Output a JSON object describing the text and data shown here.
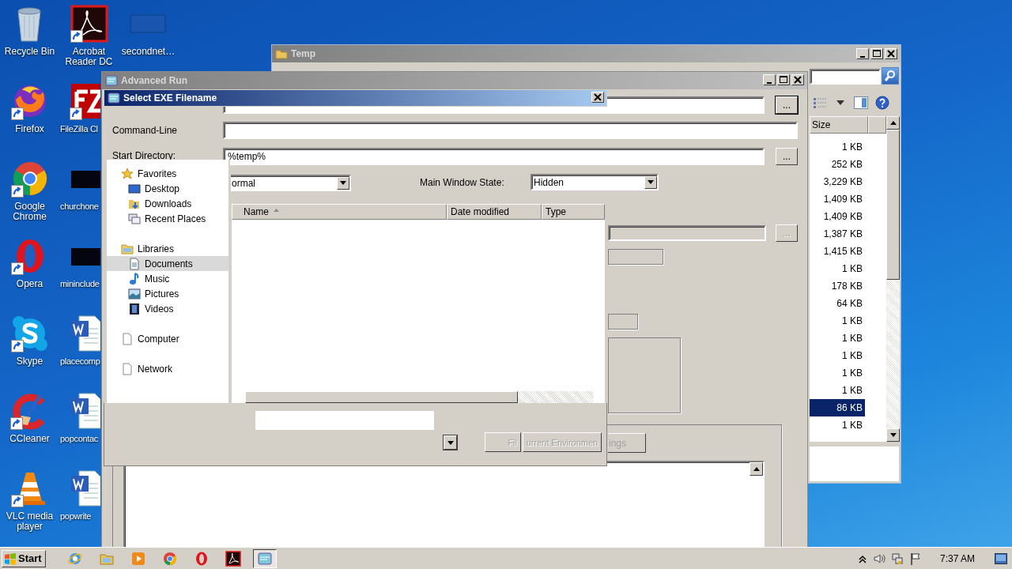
{
  "desktop": {
    "icons": [
      {
        "label": "Recycle Bin",
        "kind": "recycle",
        "shortcut": false
      },
      {
        "label": "Firefox",
        "kind": "firefox",
        "shortcut": true
      },
      {
        "label": "Google Chrome",
        "kind": "chrome",
        "shortcut": true
      },
      {
        "label": "Opera",
        "kind": "opera",
        "shortcut": true
      },
      {
        "label": "Skype",
        "kind": "skype",
        "shortcut": true
      },
      {
        "label": "CCleaner",
        "kind": "ccleaner",
        "shortcut": true
      },
      {
        "label": "VLC media player",
        "kind": "vlc",
        "shortcut": true
      },
      {
        "label": "Acrobat Reader DC",
        "kind": "acrobat",
        "shortcut": true
      },
      {
        "label": "FileZilla Cl",
        "kind": "filezilla",
        "shortcut": true
      },
      {
        "label": "churchone",
        "kind": "dark",
        "shortcut": false
      },
      {
        "label": "mininclude",
        "kind": "dark",
        "shortcut": false
      },
      {
        "label": "placecomp",
        "kind": "word",
        "shortcut": false
      },
      {
        "label": "popcontac",
        "kind": "word",
        "shortcut": false
      },
      {
        "label": "popwrite",
        "kind": "word",
        "shortcut": false
      },
      {
        "label": "secondnet…",
        "kind": "blank",
        "shortcut": false
      }
    ]
  },
  "explorer_window": {
    "title": "Temp",
    "columns": [
      "Size"
    ],
    "rows": [
      {
        "size": "1 KB",
        "selected": false
      },
      {
        "size": "252 KB",
        "selected": false
      },
      {
        "size": "3,229 KB",
        "selected": false
      },
      {
        "size": "1,409 KB",
        "selected": false
      },
      {
        "size": "1,409 KB",
        "selected": false
      },
      {
        "size": "1,387 KB",
        "selected": false
      },
      {
        "size": "1,415 KB",
        "selected": false
      },
      {
        "size": "1 KB",
        "selected": false
      },
      {
        "size": "178 KB",
        "selected": false
      },
      {
        "size": "64 KB",
        "selected": false
      },
      {
        "size": "1 KB",
        "selected": false
      },
      {
        "size": "1 KB",
        "selected": false
      },
      {
        "size": "1 KB",
        "selected": false
      },
      {
        "size": "1 KB",
        "selected": false
      },
      {
        "size": "1 KB",
        "selected": false
      },
      {
        "size": "86 KB",
        "selected": true
      },
      {
        "size": "1 KB",
        "selected": false
      }
    ]
  },
  "advanced_run": {
    "title": "Advanced Run",
    "command_line_label": "Command-Line",
    "start_directory_label": "Start Directory:",
    "start_directory": "%temp%",
    "window_mode": "ormal",
    "main_window_state_label": "Main Window State:",
    "main_window_state": "Hidden",
    "browse_buttons": [
      {
        "label": "...",
        "disabled": false
      },
      {
        "label": "...",
        "disabled": false
      },
      {
        "label": "...",
        "disabled": true
      }
    ],
    "settings_button": "ings"
  },
  "file_dialog": {
    "title": "Select EXE Filename",
    "nav": [
      {
        "label": "Favorites",
        "kind": "star",
        "selected": false,
        "children": [
          {
            "label": "Desktop",
            "kind": "desktop",
            "selected": false
          },
          {
            "label": "Downloads",
            "kind": "downloads",
            "selected": false
          },
          {
            "label": "Recent Places",
            "kind": "recent",
            "selected": false
          }
        ]
      },
      {
        "label": "Libraries",
        "kind": "libraries",
        "selected": false,
        "children": [
          {
            "label": "Documents",
            "kind": "document",
            "selected": true
          },
          {
            "label": "Music",
            "kind": "music",
            "selected": false
          },
          {
            "label": "Pictures",
            "kind": "pictures",
            "selected": false
          },
          {
            "label": "Videos",
            "kind": "videos",
            "selected": false
          }
        ]
      },
      {
        "label": "Computer",
        "kind": "page",
        "selected": false
      },
      {
        "label": "Network",
        "kind": "page",
        "selected": false
      }
    ],
    "columns": [
      {
        "label": "Name",
        "sorted": true
      },
      {
        "label": "Date modified",
        "sorted": false
      },
      {
        "label": "Type",
        "sorted": false
      }
    ],
    "buttons": [
      {
        "label": "Fil",
        "disabled": true
      },
      {
        "label": "urrent Environmen",
        "disabled": true
      }
    ]
  },
  "taskbar": {
    "start": "Start",
    "apps": [
      {
        "kind": "ie",
        "selected": false
      },
      {
        "kind": "explorer",
        "selected": false
      },
      {
        "kind": "media",
        "selected": false
      },
      {
        "kind": "chrome",
        "selected": false
      },
      {
        "kind": "opera",
        "selected": false
      },
      {
        "kind": "acrobat",
        "selected": false
      },
      {
        "kind": "advrun",
        "selected": true
      }
    ],
    "clock": "7:37 AM"
  }
}
